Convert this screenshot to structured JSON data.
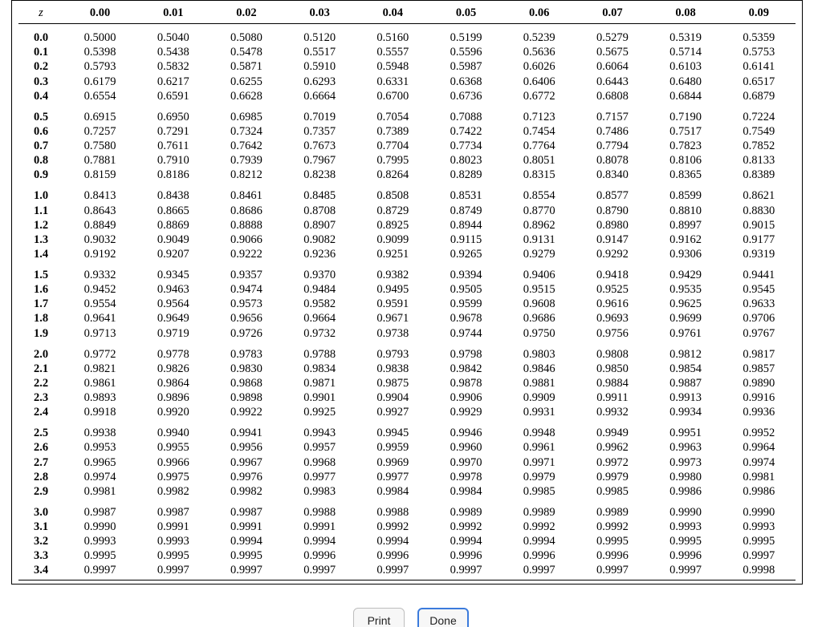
{
  "z_label": "z",
  "col_headers": [
    "0.00",
    "0.01",
    "0.02",
    "0.03",
    "0.04",
    "0.05",
    "0.06",
    "0.07",
    "0.08",
    "0.09"
  ],
  "groups": [
    {
      "rows": [
        {
          "z": "0.0",
          "v": [
            "0.5000",
            "0.5040",
            "0.5080",
            "0.5120",
            "0.5160",
            "0.5199",
            "0.5239",
            "0.5279",
            "0.5319",
            "0.5359"
          ]
        },
        {
          "z": "0.1",
          "v": [
            "0.5398",
            "0.5438",
            "0.5478",
            "0.5517",
            "0.5557",
            "0.5596",
            "0.5636",
            "0.5675",
            "0.5714",
            "0.5753"
          ]
        },
        {
          "z": "0.2",
          "v": [
            "0.5793",
            "0.5832",
            "0.5871",
            "0.5910",
            "0.5948",
            "0.5987",
            "0.6026",
            "0.6064",
            "0.6103",
            "0.6141"
          ]
        },
        {
          "z": "0.3",
          "v": [
            "0.6179",
            "0.6217",
            "0.6255",
            "0.6293",
            "0.6331",
            "0.6368",
            "0.6406",
            "0.6443",
            "0.6480",
            "0.6517"
          ]
        },
        {
          "z": "0.4",
          "v": [
            "0.6554",
            "0.6591",
            "0.6628",
            "0.6664",
            "0.6700",
            "0.6736",
            "0.6772",
            "0.6808",
            "0.6844",
            "0.6879"
          ]
        }
      ]
    },
    {
      "rows": [
        {
          "z": "0.5",
          "v": [
            "0.6915",
            "0.6950",
            "0.6985",
            "0.7019",
            "0.7054",
            "0.7088",
            "0.7123",
            "0.7157",
            "0.7190",
            "0.7224"
          ]
        },
        {
          "z": "0.6",
          "v": [
            "0.7257",
            "0.7291",
            "0.7324",
            "0.7357",
            "0.7389",
            "0.7422",
            "0.7454",
            "0.7486",
            "0.7517",
            "0.7549"
          ]
        },
        {
          "z": "0.7",
          "v": [
            "0.7580",
            "0.7611",
            "0.7642",
            "0.7673",
            "0.7704",
            "0.7734",
            "0.7764",
            "0.7794",
            "0.7823",
            "0.7852"
          ]
        },
        {
          "z": "0.8",
          "v": [
            "0.7881",
            "0.7910",
            "0.7939",
            "0.7967",
            "0.7995",
            "0.8023",
            "0.8051",
            "0.8078",
            "0.8106",
            "0.8133"
          ]
        },
        {
          "z": "0.9",
          "v": [
            "0.8159",
            "0.8186",
            "0.8212",
            "0.8238",
            "0.8264",
            "0.8289",
            "0.8315",
            "0.8340",
            "0.8365",
            "0.8389"
          ]
        }
      ]
    },
    {
      "rows": [
        {
          "z": "1.0",
          "v": [
            "0.8413",
            "0.8438",
            "0.8461",
            "0.8485",
            "0.8508",
            "0.8531",
            "0.8554",
            "0.8577",
            "0.8599",
            "0.8621"
          ]
        },
        {
          "z": "1.1",
          "v": [
            "0.8643",
            "0.8665",
            "0.8686",
            "0.8708",
            "0.8729",
            "0.8749",
            "0.8770",
            "0.8790",
            "0.8810",
            "0.8830"
          ]
        },
        {
          "z": "1.2",
          "v": [
            "0.8849",
            "0.8869",
            "0.8888",
            "0.8907",
            "0.8925",
            "0.8944",
            "0.8962",
            "0.8980",
            "0.8997",
            "0.9015"
          ]
        },
        {
          "z": "1.3",
          "v": [
            "0.9032",
            "0.9049",
            "0.9066",
            "0.9082",
            "0.9099",
            "0.9115",
            "0.9131",
            "0.9147",
            "0.9162",
            "0.9177"
          ]
        },
        {
          "z": "1.4",
          "v": [
            "0.9192",
            "0.9207",
            "0.9222",
            "0.9236",
            "0.9251",
            "0.9265",
            "0.9279",
            "0.9292",
            "0.9306",
            "0.9319"
          ]
        }
      ]
    },
    {
      "rows": [
        {
          "z": "1.5",
          "v": [
            "0.9332",
            "0.9345",
            "0.9357",
            "0.9370",
            "0.9382",
            "0.9394",
            "0.9406",
            "0.9418",
            "0.9429",
            "0.9441"
          ]
        },
        {
          "z": "1.6",
          "v": [
            "0.9452",
            "0.9463",
            "0.9474",
            "0.9484",
            "0.9495",
            "0.9505",
            "0.9515",
            "0.9525",
            "0.9535",
            "0.9545"
          ]
        },
        {
          "z": "1.7",
          "v": [
            "0.9554",
            "0.9564",
            "0.9573",
            "0.9582",
            "0.9591",
            "0.9599",
            "0.9608",
            "0.9616",
            "0.9625",
            "0.9633"
          ]
        },
        {
          "z": "1.8",
          "v": [
            "0.9641",
            "0.9649",
            "0.9656",
            "0.9664",
            "0.9671",
            "0.9678",
            "0.9686",
            "0.9693",
            "0.9699",
            "0.9706"
          ]
        },
        {
          "z": "1.9",
          "v": [
            "0.9713",
            "0.9719",
            "0.9726",
            "0.9732",
            "0.9738",
            "0.9744",
            "0.9750",
            "0.9756",
            "0.9761",
            "0.9767"
          ]
        }
      ]
    },
    {
      "rows": [
        {
          "z": "2.0",
          "v": [
            "0.9772",
            "0.9778",
            "0.9783",
            "0.9788",
            "0.9793",
            "0.9798",
            "0.9803",
            "0.9808",
            "0.9812",
            "0.9817"
          ]
        },
        {
          "z": "2.1",
          "v": [
            "0.9821",
            "0.9826",
            "0.9830",
            "0.9834",
            "0.9838",
            "0.9842",
            "0.9846",
            "0.9850",
            "0.9854",
            "0.9857"
          ]
        },
        {
          "z": "2.2",
          "v": [
            "0.9861",
            "0.9864",
            "0.9868",
            "0.9871",
            "0.9875",
            "0.9878",
            "0.9881",
            "0.9884",
            "0.9887",
            "0.9890"
          ]
        },
        {
          "z": "2.3",
          "v": [
            "0.9893",
            "0.9896",
            "0.9898",
            "0.9901",
            "0.9904",
            "0.9906",
            "0.9909",
            "0.9911",
            "0.9913",
            "0.9916"
          ]
        },
        {
          "z": "2.4",
          "v": [
            "0.9918",
            "0.9920",
            "0.9922",
            "0.9925",
            "0.9927",
            "0.9929",
            "0.9931",
            "0.9932",
            "0.9934",
            "0.9936"
          ]
        }
      ]
    },
    {
      "rows": [
        {
          "z": "2.5",
          "v": [
            "0.9938",
            "0.9940",
            "0.9941",
            "0.9943",
            "0.9945",
            "0.9946",
            "0.9948",
            "0.9949",
            "0.9951",
            "0.9952"
          ]
        },
        {
          "z": "2.6",
          "v": [
            "0.9953",
            "0.9955",
            "0.9956",
            "0.9957",
            "0.9959",
            "0.9960",
            "0.9961",
            "0.9962",
            "0.9963",
            "0.9964"
          ]
        },
        {
          "z": "2.7",
          "v": [
            "0.9965",
            "0.9966",
            "0.9967",
            "0.9968",
            "0.9969",
            "0.9970",
            "0.9971",
            "0.9972",
            "0.9973",
            "0.9974"
          ]
        },
        {
          "z": "2.8",
          "v": [
            "0.9974",
            "0.9975",
            "0.9976",
            "0.9977",
            "0.9977",
            "0.9978",
            "0.9979",
            "0.9979",
            "0.9980",
            "0.9981"
          ]
        },
        {
          "z": "2.9",
          "v": [
            "0.9981",
            "0.9982",
            "0.9982",
            "0.9983",
            "0.9984",
            "0.9984",
            "0.9985",
            "0.9985",
            "0.9986",
            "0.9986"
          ]
        }
      ]
    },
    {
      "rows": [
        {
          "z": "3.0",
          "v": [
            "0.9987",
            "0.9987",
            "0.9987",
            "0.9988",
            "0.9988",
            "0.9989",
            "0.9989",
            "0.9989",
            "0.9990",
            "0.9990"
          ]
        },
        {
          "z": "3.1",
          "v": [
            "0.9990",
            "0.9991",
            "0.9991",
            "0.9991",
            "0.9992",
            "0.9992",
            "0.9992",
            "0.9992",
            "0.9993",
            "0.9993"
          ]
        },
        {
          "z": "3.2",
          "v": [
            "0.9993",
            "0.9993",
            "0.9994",
            "0.9994",
            "0.9994",
            "0.9994",
            "0.9994",
            "0.9995",
            "0.9995",
            "0.9995"
          ]
        },
        {
          "z": "3.3",
          "v": [
            "0.9995",
            "0.9995",
            "0.9995",
            "0.9996",
            "0.9996",
            "0.9996",
            "0.9996",
            "0.9996",
            "0.9996",
            "0.9997"
          ]
        },
        {
          "z": "3.4",
          "v": [
            "0.9997",
            "0.9997",
            "0.9997",
            "0.9997",
            "0.9997",
            "0.9997",
            "0.9997",
            "0.9997",
            "0.9997",
            "0.9998"
          ]
        }
      ]
    }
  ],
  "buttons": {
    "print": "Print",
    "done": "Done"
  }
}
